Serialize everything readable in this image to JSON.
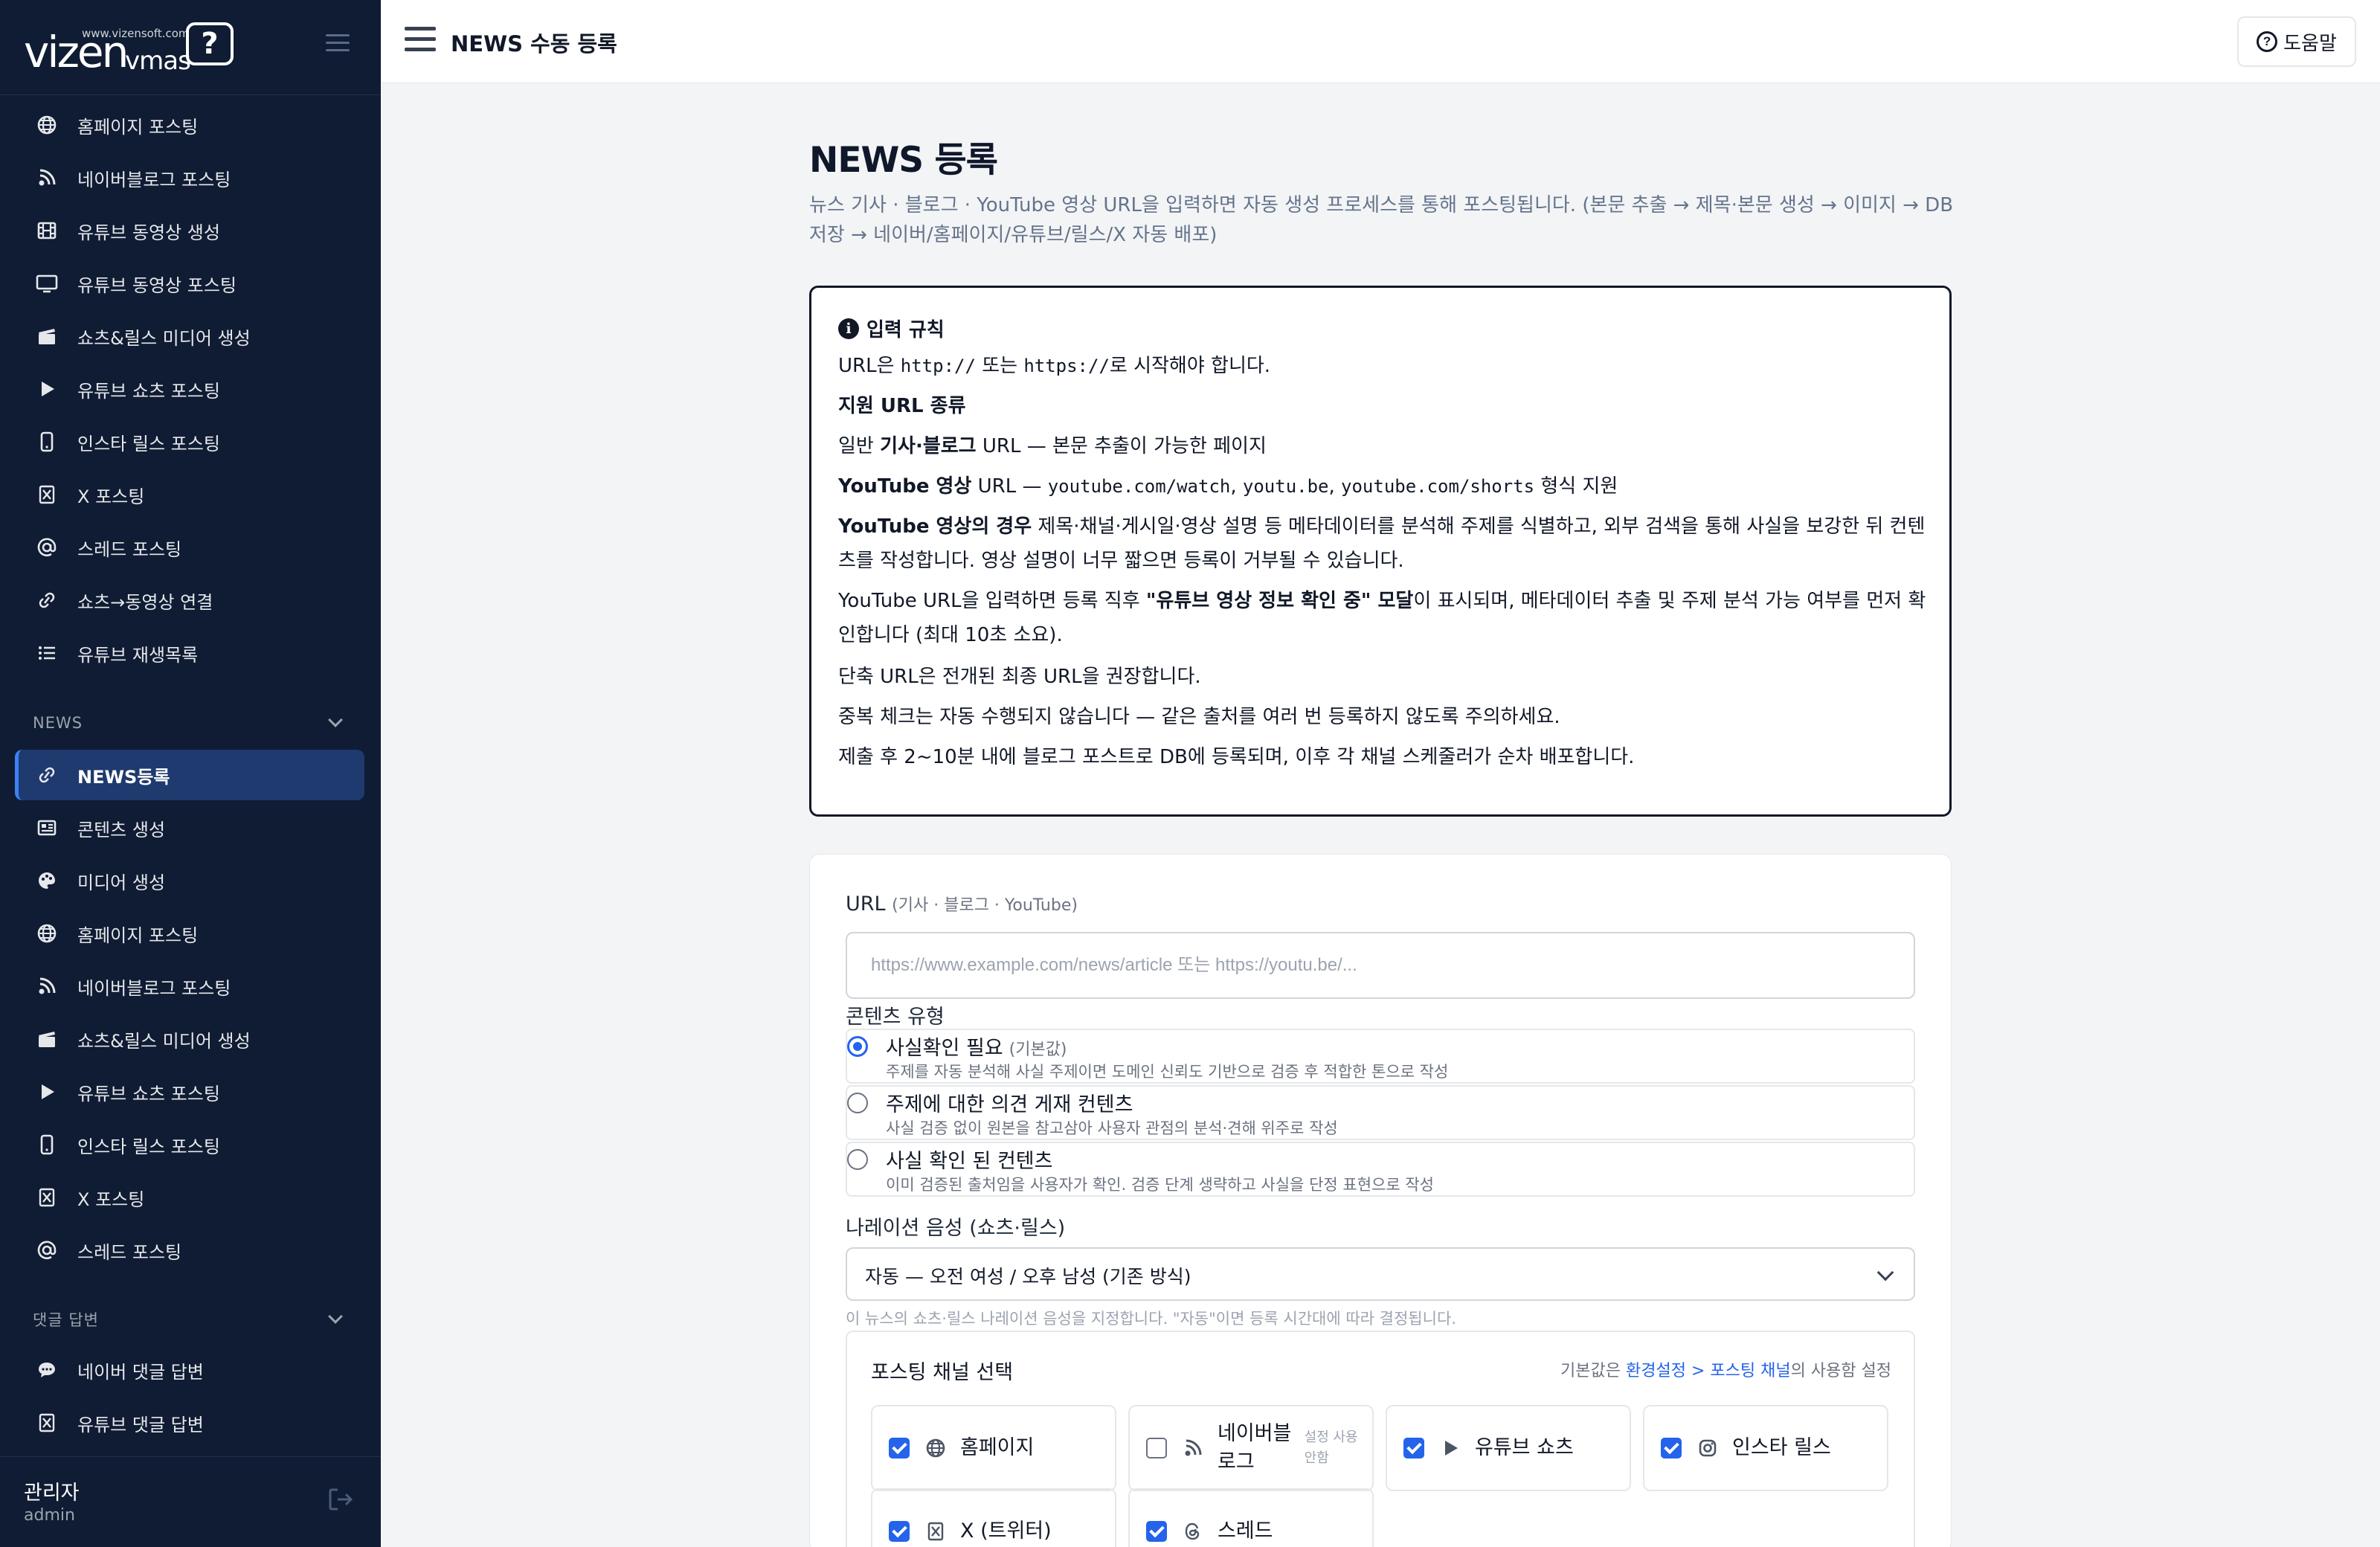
{
  "sidebar": {
    "logo_word": "vizen",
    "logo_sub": "vmas",
    "logo_url": "www.vizensoft.com",
    "logo_mark": "?",
    "items_top": [
      {
        "label": "홈페이지 포스팅",
        "icon": "globe-icon"
      },
      {
        "label": "네이버블로그 포스팅",
        "icon": "blog-icon"
      },
      {
        "label": "유튜브 동영상 생성",
        "icon": "film-icon"
      },
      {
        "label": "유튜브 동영상 포스팅",
        "icon": "monitor-icon"
      },
      {
        "label": "쇼츠&릴스 미디어 생성",
        "icon": "clapper-icon"
      },
      {
        "label": "유튜브 쇼츠 포스팅",
        "icon": "play-icon"
      },
      {
        "label": "인스타 릴스 포스팅",
        "icon": "phone-icon"
      },
      {
        "label": "X 포스팅",
        "icon": "x-icon"
      },
      {
        "label": "스레드 포스팅",
        "icon": "at-icon"
      },
      {
        "label": "쇼츠→동영상 연결",
        "icon": "link-icon"
      },
      {
        "label": "유튜브 재생목록",
        "icon": "list-icon"
      }
    ],
    "section_news": "NEWS",
    "items_news": [
      {
        "label": "NEWS등록",
        "icon": "link-icon",
        "active": true
      },
      {
        "label": "콘텐츠 생성",
        "icon": "newspaper-icon"
      },
      {
        "label": "미디어 생성",
        "icon": "palette-icon"
      },
      {
        "label": "홈페이지 포스팅",
        "icon": "globe-icon"
      },
      {
        "label": "네이버블로그 포스팅",
        "icon": "blog-icon"
      },
      {
        "label": "쇼츠&릴스 미디어 생성",
        "icon": "clapper-icon"
      },
      {
        "label": "유튜브 쇼츠 포스팅",
        "icon": "play-icon"
      },
      {
        "label": "인스타 릴스 포스팅",
        "icon": "phone-icon"
      },
      {
        "label": "X 포스팅",
        "icon": "x-icon"
      },
      {
        "label": "스레드 포스팅",
        "icon": "at-icon"
      }
    ],
    "section_comments": "댓글 답변",
    "items_comments": [
      {
        "label": "네이버 댓글 답변",
        "icon": "chat-icon"
      },
      {
        "label": "유튜브 댓글 답변",
        "icon": "x-icon"
      }
    ],
    "user_name": "관리자",
    "user_id": "admin"
  },
  "topbar": {
    "title": "NEWS 수동 등록",
    "help_label": "도움말",
    "help_glyph": "?"
  },
  "main": {
    "title": "NEWS 등록",
    "description": "뉴스 기사 · 블로그 · YouTube 영상 URL을 입력하면 자동 생성 프로세스를 통해 포스팅됩니다. (본문 추출 → 제목·본문 생성 → 이미지 → DB 저장 → 네이버/홈페이지/유튜브/릴스/X 자동 배포)",
    "rules": {
      "heading": "입력 규칙",
      "info_glyph": "i",
      "r1_a": "URL은 ",
      "r1_code1": "http://",
      "r1_b": " 또는 ",
      "r1_code2": "https://",
      "r1_c": "로 시작해야 합니다.",
      "r2": "지원 URL 종류",
      "r3_a": "일반 ",
      "r3_bold": "기사·블로그",
      "r3_b": " URL — 본문 추출이 가능한 페이지",
      "r4_bold": "YouTube 영상",
      "r4_a": " URL — ",
      "r4_code1": "youtube.com/watch",
      "r4_sep1": ", ",
      "r4_code2": "youtu.be",
      "r4_sep2": ", ",
      "r4_code3": "youtube.com/shorts",
      "r4_b": " 형식 지원",
      "r5_bold": "YouTube 영상의 경우",
      "r5_a": " 제목·채널·게시일·영상 설명 등 메타데이터를 분석해 주제를 식별하고, 외부 검색을 통해 사실을 보강한 뒤 컨텐츠를 작성합니다. 영상 설명이 너무 짧으면 등록이 거부될 수 있습니다.",
      "r6_a": "YouTube URL을 입력하면 등록 직후 ",
      "r6_bold": "\"유튜브 영상 정보 확인 중\" 모달",
      "r6_b": "이 표시되며, 메타데이터 추출 및 주제 분석 가능 여부를 먼저 확인합니다 (최대 10초 소요).",
      "r7": "단축 URL은 전개된 최종 URL을 권장합니다.",
      "r8": "중복 체크는 자동 수행되지 않습니다 — 같은 출처를 여러 번 등록하지 않도록 주의하세요.",
      "r9": "제출 후 2~10분 내에 블로그 포스트로 DB에 등록되며, 이후 각 채널 스케줄러가 순차 배포합니다."
    },
    "form": {
      "url_label": "URL",
      "url_sub": "(기사 · 블로그 · YouTube)",
      "url_placeholder": "https://www.example.com/news/article 또는 https://youtu.be/...",
      "url_value": "",
      "type_label": "콘텐츠 유형",
      "types": [
        {
          "title": "사실확인 필요",
          "badge": "(기본값)",
          "desc": "주제를 자동 분석해 사실 주제이면 도메인 신뢰도 기반으로 검증 후 적합한 톤으로 작성",
          "selected": true
        },
        {
          "title": "주제에 대한 의견 게재 컨텐츠",
          "badge": "",
          "desc": "사실 검증 없이 원본을 참고삼아 사용자 관점의 분석·견해 위주로 작성",
          "selected": false
        },
        {
          "title": "사실 확인 된 컨텐츠",
          "badge": "",
          "desc": "이미 검증된 출처임을 사용자가 확인. 검증 단계 생략하고 사실을 단정 표현으로 작성",
          "selected": false
        }
      ],
      "voice_label": "나레이션 음성 (쇼츠·릴스)",
      "voice_value": "자동 — 오전 여성 / 오후 남성 (기존 방식)",
      "voice_hint": "이 뉴스의 쇼츠·릴스 나레이션 음성을 지정합니다. \"자동\"이면 등록 시간대에 따라 결정됩니다.",
      "channels_title": "포스팅 채널 선택",
      "channels_note_a": "기본값은 ",
      "channels_note_link": "환경설정 > 포스팅 채널",
      "channels_note_b": "의 사용함 설정",
      "channels": [
        {
          "label": "홈페이지",
          "checked": true,
          "icon": "globe-icon",
          "note": ""
        },
        {
          "label": "네이버블로그",
          "checked": false,
          "icon": "blog-icon",
          "note": "설정 사용 안함"
        },
        {
          "label": "유튜브 쇼츠",
          "checked": true,
          "icon": "play-icon",
          "note": ""
        },
        {
          "label": "인스타 릴스",
          "checked": true,
          "icon": "instagram-icon",
          "note": ""
        },
        {
          "label": "X (트위터)",
          "checked": true,
          "icon": "x-icon",
          "note": ""
        },
        {
          "label": "스레드",
          "checked": true,
          "icon": "threads-icon",
          "note": ""
        }
      ]
    }
  },
  "colors": {
    "sidebar_bg": "#0f1c33",
    "active_bg": "#1e3a6e",
    "accent": "#2563eb"
  }
}
